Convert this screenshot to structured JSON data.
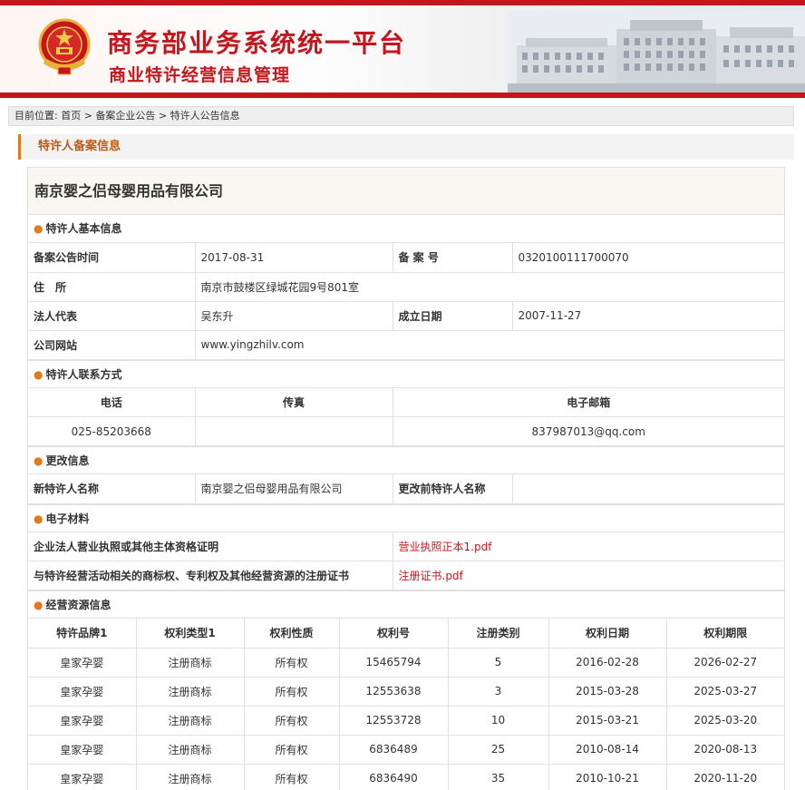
{
  "header": {
    "title": "商务部业务系统统一平台",
    "subtitle": "商业特许经营信息管理",
    "emblem_icon": "national-emblem-icon",
    "colors": {
      "brand_red": "#c4161c",
      "accent_orange": "#e07a1f"
    }
  },
  "breadcrumb": {
    "prefix": "目前位置:",
    "items": [
      "首页",
      "备案企业公告",
      "特许人公告信息"
    ],
    "separator": ">"
  },
  "section_title": "特许人备案信息",
  "company_name": "南京婴之侣母婴用品有限公司",
  "basic_info": {
    "heading": "特许人基本信息",
    "record_date_label": "备案公告时间",
    "record_date": "2017-08-31",
    "record_no_label": "备 案 号",
    "record_no": "0320100111700070",
    "address_label": "住　所",
    "address": "南京市鼓楼区绿城花园9号801室",
    "legal_rep_label": "法人代表",
    "legal_rep": "吴东升",
    "founded_label": "成立日期",
    "founded": "2007-11-27",
    "website_label": "公司网站",
    "website": "www.yingzhilv.com"
  },
  "contact": {
    "heading": "特许人联系方式",
    "phone_label": "电话",
    "fax_label": "传真",
    "email_label": "电子邮箱",
    "phone": "025-85203668",
    "fax": "",
    "email": "837987013@qq.com"
  },
  "changes": {
    "heading": "更改信息",
    "new_name_label": "新特许人名称",
    "new_name": "南京婴之侣母婴用品有限公司",
    "old_name_label": "更改前特许人名称",
    "old_name": ""
  },
  "materials": {
    "heading": "电子材料",
    "items": [
      {
        "label": "企业法人营业执照或其他主体资格证明",
        "file": "营业执照正本1.pdf"
      },
      {
        "label": "与特许经营活动相关的商标权、专利权及其他经营资源的注册证书",
        "file": "注册证书.pdf"
      }
    ]
  },
  "resources": {
    "heading": "经营资源信息",
    "columns": [
      "特许品牌1",
      "权利类型1",
      "权利性质",
      "权利号",
      "注册类别",
      "权利日期",
      "权利期限"
    ],
    "rows": [
      [
        "皇家孕婴",
        "注册商标",
        "所有权",
        "15465794",
        "5",
        "2016-02-28",
        "2026-02-27"
      ],
      [
        "皇家孕婴",
        "注册商标",
        "所有权",
        "12553638",
        "3",
        "2015-03-28",
        "2025-03-27"
      ],
      [
        "皇家孕婴",
        "注册商标",
        "所有权",
        "12553728",
        "10",
        "2015-03-21",
        "2025-03-20"
      ],
      [
        "皇家孕婴",
        "注册商标",
        "所有权",
        "6836489",
        "25",
        "2010-08-14",
        "2020-08-13"
      ],
      [
        "皇家孕婴",
        "注册商标",
        "所有权",
        "6836490",
        "35",
        "2010-10-21",
        "2020-11-20"
      ]
    ]
  }
}
